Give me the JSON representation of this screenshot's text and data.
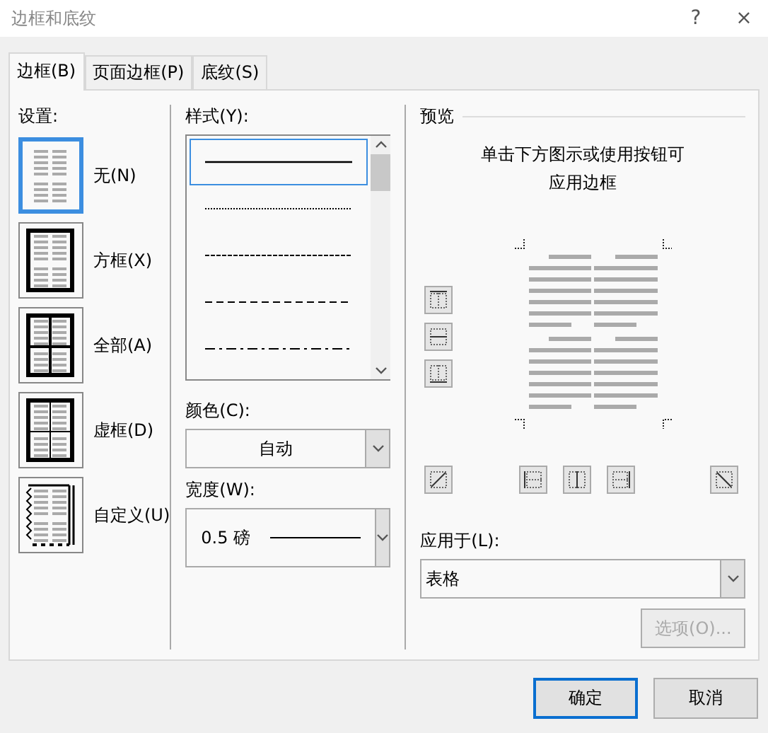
{
  "window": {
    "title": "边框和底纹",
    "help": "?",
    "close": "×"
  },
  "tabs": [
    {
      "label": "边框(B)",
      "selected": true
    },
    {
      "label": "页面边框(P)",
      "selected": false
    },
    {
      "label": "底纹(S)",
      "selected": false
    }
  ],
  "settings": {
    "label": "设置:",
    "items": [
      {
        "label": "无(N)",
        "kind": "none",
        "selected": true
      },
      {
        "label": "方框(X)",
        "kind": "box",
        "selected": false
      },
      {
        "label": "全部(A)",
        "kind": "all",
        "selected": false
      },
      {
        "label": "虚框(D)",
        "kind": "grid",
        "selected": false
      },
      {
        "label": "自定义(U)",
        "kind": "custom",
        "selected": false
      }
    ]
  },
  "style": {
    "label": "样式(Y):",
    "items": [
      {
        "kind": "solid",
        "selected": true
      },
      {
        "kind": "dotted",
        "selected": false
      },
      {
        "kind": "dashed-small",
        "selected": false
      },
      {
        "kind": "dashed",
        "selected": false
      },
      {
        "kind": "dash-dot",
        "selected": false
      }
    ]
  },
  "color": {
    "label": "颜色(C):",
    "value": "自动"
  },
  "width": {
    "label": "宽度(W):",
    "value": "0.5 磅"
  },
  "preview": {
    "label": "预览",
    "instruction_lines": [
      "单击下方图示或使用按钮可",
      "应用边框"
    ]
  },
  "apply_to": {
    "label": "应用于(L):",
    "value": "表格"
  },
  "options_button": {
    "label": "选项(O)...",
    "disabled": true
  },
  "buttons": [
    {
      "label": "确定",
      "default": true
    },
    {
      "label": "取消",
      "default": false
    }
  ]
}
